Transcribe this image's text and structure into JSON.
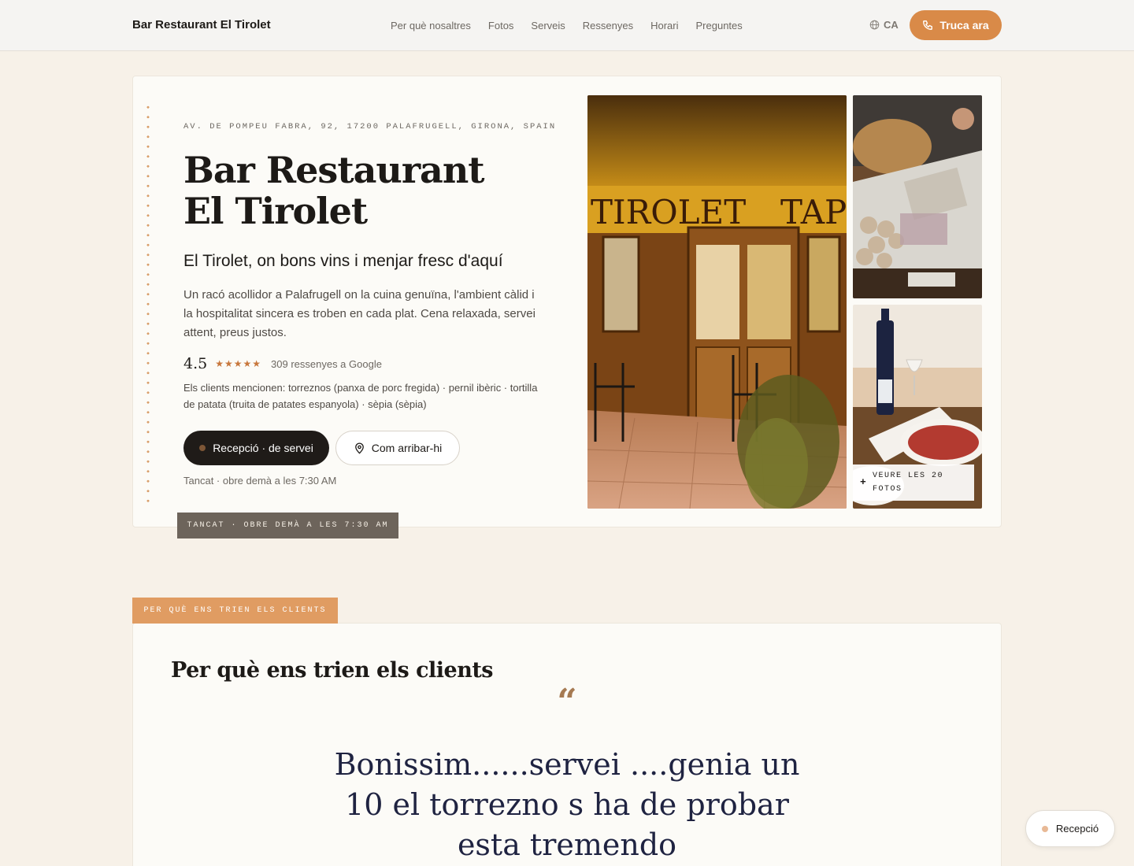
{
  "nav": {
    "brand": "Bar Restaurant El Tirolet",
    "links": [
      "Per què nosaltres",
      "Fotos",
      "Serveis",
      "Ressenyes",
      "Horari",
      "Preguntes"
    ],
    "language": "CA",
    "call_label": "Truca ara",
    "accent_color": "#d98a48"
  },
  "hero": {
    "address": "AV. DE POMPEU FABRA, 92, 17200 PALAFRUGELL, GIRONA, SPAIN",
    "title": "Bar Restaurant El Tirolet",
    "subtitle": "El Tirolet, on bons vins i menjar fresc d'aquí",
    "description": "Un racó acollidor a Palafrugell on la cuina genuïna, l'ambient càlid i la hospitalitat sincera es troben en cada plat. Cena relaxada, servei attent, preus justos.",
    "rating": "4.5",
    "stars": "★★★★★",
    "reviews": "309 ressenyes a Google",
    "mentions": "Els clients mencionen: torreznos (panxa de porc fregida) · pernil ibèric · tortilla de patata (truita de patates espanyola) · sèpia (sèpia)",
    "primary_button": "Recepció · de servei",
    "secondary_button": "Com arribar-hi",
    "status": "Tancat · obre demà a les 7:30 AM",
    "status_tag": "TANCAT · OBRE DEMÀ A LES 7:30 AM"
  },
  "photos": {
    "see_all": "VEURE LES 20 FOTOS",
    "plus": "+"
  },
  "why": {
    "tag": "PER QUÈ ENS TRIEN ELS CLIENTS",
    "title": "Per què ens trien els clients",
    "quote_mark": "“",
    "quote": "Bonissim......servei ....genia un 10 el torrezno s ha de probar esta tremendo"
  },
  "floating": {
    "label": "Recepció"
  }
}
